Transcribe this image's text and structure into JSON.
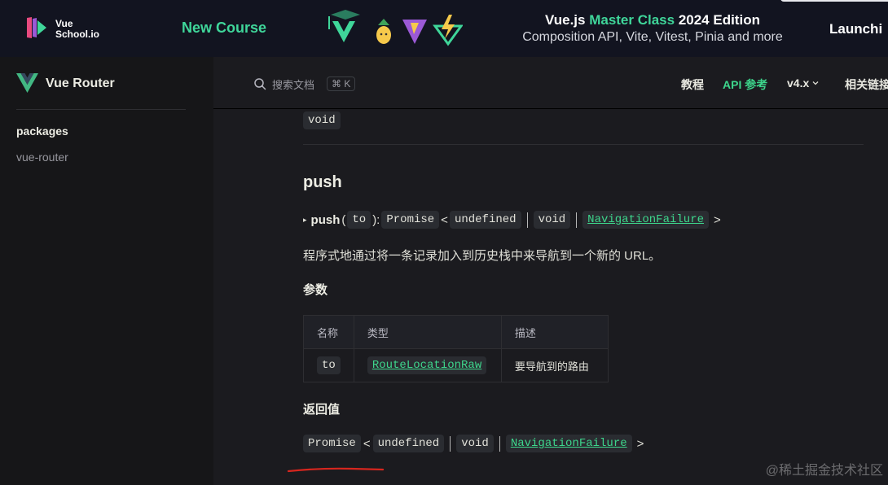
{
  "banner": {
    "school_line1": "Vue",
    "school_line2": "School.io",
    "new_course": "New Course",
    "mc_title_start": "Vue.js ",
    "mc_title_accent": "Master Class",
    "mc_title_end": " 2024 Edition",
    "mc_subtitle": "Composition API, Vite, Vitest, Pinia and more",
    "cta": "Launchi",
    "colors": {
      "bg": "#121420",
      "accent": "#3fd69a"
    },
    "icons": [
      "vue-graduation-icon",
      "pineapple-icon",
      "vite-icon",
      "vitest-icon"
    ]
  },
  "sidebar": {
    "brand": "Vue Router",
    "group_title": "packages",
    "items": [
      {
        "label": "vue-router"
      }
    ]
  },
  "topbar": {
    "search_placeholder": "搜索文档",
    "search_kbd": "⌘ K",
    "nav": [
      {
        "label": "教程",
        "active": false
      },
      {
        "label": "API 参考",
        "active": true
      },
      {
        "label": "v4.x",
        "dropdown": true
      },
      {
        "label": "相关链接"
      }
    ],
    "accent": "#3dd68c"
  },
  "content": {
    "prev_return_type": "void",
    "push_heading": "push",
    "signature": {
      "name": "push",
      "open": "(",
      "param": "to",
      "close": "):",
      "promise": "Promise",
      "lt": "<",
      "t1": "undefined",
      "t2": "void",
      "t3": "NavigationFailure",
      "gt": ">"
    },
    "description": "程序式地通过将一条记录加入到历史栈中来导航到一个新的 URL。",
    "params_heading": "参数",
    "params_table": {
      "headers": [
        "名称",
        "类型",
        "描述"
      ],
      "rows": [
        {
          "name": "to",
          "type": "RouteLocationRaw",
          "desc": "要导航到的路由"
        }
      ]
    },
    "returns_heading": "返回值",
    "returns": {
      "promise": "Promise",
      "lt": "<",
      "t1": "undefined",
      "t2": "void",
      "t3": "NavigationFailure",
      "gt": ">"
    },
    "annotation_color": "#d7261e"
  },
  "watermark": "@稀土掘金技术社区"
}
